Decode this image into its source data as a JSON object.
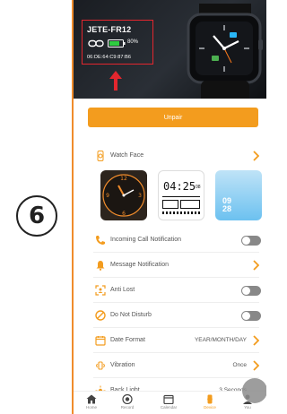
{
  "step_number": "6",
  "device": {
    "name": "JETE-FR12",
    "battery": "80%",
    "mac": "06:DE:64:C9:87:B6"
  },
  "unpair_label": "Unpair",
  "watch_face": {
    "label": "Watch Face",
    "preview_digital_time": "04:25",
    "preview_digital_sec": "08",
    "preview_blue_time_top": "09",
    "preview_blue_time_bottom": "28"
  },
  "settings": [
    {
      "label": "Incoming Call Notification",
      "control": "toggle",
      "on": false
    },
    {
      "label": "Message Notification",
      "control": "chevron"
    },
    {
      "label": "Anti Lost",
      "control": "toggle",
      "on": false
    },
    {
      "label": "Do Not Disturb",
      "control": "toggle",
      "on": false
    },
    {
      "label": "Date Format",
      "control": "chevron",
      "value": "YEAR/MONTH/DAY"
    },
    {
      "label": "Vibration",
      "control": "chevron",
      "value": "Once"
    },
    {
      "label": "Back Light",
      "control": "chevron",
      "value": "3 Seconds"
    }
  ],
  "tabs": [
    {
      "label": "Home",
      "icon": "home-icon",
      "active": false
    },
    {
      "label": "Record",
      "icon": "record-icon",
      "active": false
    },
    {
      "label": "Calendar",
      "icon": "calendar-icon",
      "active": false
    },
    {
      "label": "Device",
      "icon": "device-icon",
      "active": true
    },
    {
      "label": "You",
      "icon": "person-icon",
      "active": false
    }
  ],
  "colors": {
    "accent": "#f39c1e",
    "highlight_red": "#e3262e",
    "toggle_off": "#888888",
    "battery_green": "#2ecc40"
  }
}
